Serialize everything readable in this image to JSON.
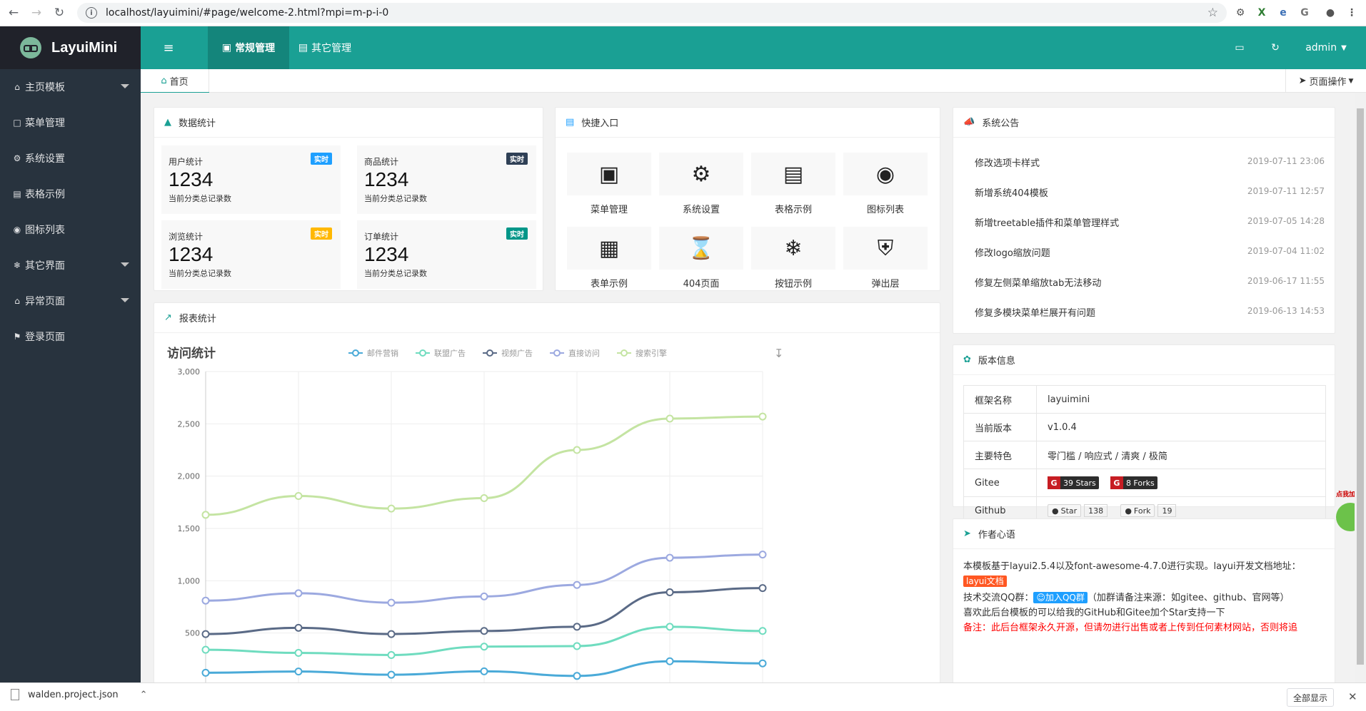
{
  "browser": {
    "url": "localhost/layuimini/#page/welcome-2.html?mpi=m-p-i-0",
    "download_file": "walden.project.json",
    "show_all": "全部显示"
  },
  "sidebar": {
    "logo_text": "LayuiMini",
    "items": [
      {
        "icon": "home-icon",
        "label": "主页模板",
        "has_submenu": true
      },
      {
        "icon": "window-icon",
        "label": "菜单管理",
        "has_submenu": false
      },
      {
        "icon": "gears-icon",
        "label": "系统设置",
        "has_submenu": false
      },
      {
        "icon": "file-icon",
        "label": "表格示例",
        "has_submenu": false
      },
      {
        "icon": "circle-dot-icon",
        "label": "图标列表",
        "has_submenu": false
      },
      {
        "icon": "snowflake-icon",
        "label": "其它界面",
        "has_submenu": true
      },
      {
        "icon": "home-icon",
        "label": "异常页面",
        "has_submenu": true
      },
      {
        "icon": "flag-icon",
        "label": "登录页面",
        "has_submenu": false
      }
    ]
  },
  "header": {
    "menu_tabs": [
      {
        "label": "常规管理",
        "active": true
      },
      {
        "label": "其它管理",
        "active": false
      }
    ],
    "user": "admin"
  },
  "tabs": {
    "home": "首页",
    "page_ops": "页面操作"
  },
  "stats": {
    "title": "数据统计",
    "items": [
      {
        "title": "用户统计",
        "value": "1234",
        "desc": "当前分类总记录数",
        "badge": "实时",
        "badge_color": "#1e9fff"
      },
      {
        "title": "商品统计",
        "value": "1234",
        "desc": "当前分类总记录数",
        "badge": "实时",
        "badge_color": "#2f4056"
      },
      {
        "title": "浏览统计",
        "value": "1234",
        "desc": "当前分类总记录数",
        "badge": "实时",
        "badge_color": "#ffb800"
      },
      {
        "title": "订单统计",
        "value": "1234",
        "desc": "当前分类总记录数",
        "badge": "实时",
        "badge_color": "#009688"
      }
    ]
  },
  "quick": {
    "title": "快捷入口",
    "items": [
      {
        "icon": "window-icon",
        "label": "菜单管理"
      },
      {
        "icon": "gears-icon",
        "label": "系统设置"
      },
      {
        "icon": "file-text-icon",
        "label": "表格示例"
      },
      {
        "icon": "dot-circle-icon",
        "label": "图标列表"
      },
      {
        "icon": "calendar-icon",
        "label": "表单示例"
      },
      {
        "icon": "hourglass-icon",
        "label": "404页面"
      },
      {
        "icon": "snowflake-icon",
        "label": "按钮示例"
      },
      {
        "icon": "shield-icon",
        "label": "弹出层"
      }
    ]
  },
  "report": {
    "title": "报表统计"
  },
  "chart_data": {
    "type": "line",
    "title": "访问统计",
    "ylim": [
      0,
      3000
    ],
    "yticks": [
      "3,000",
      "2,500",
      "2,000",
      "1,500",
      "1,000",
      "500"
    ],
    "x_count": 7,
    "series": [
      {
        "name": "邮件营销",
        "color": "#4aaad8",
        "values": [
          120,
          132,
          101,
          134,
          90,
          230,
          210
        ]
      },
      {
        "name": "联盟广告",
        "color": "#6fdcbf",
        "values": [
          340,
          310,
          290,
          370,
          375,
          560,
          520
        ]
      },
      {
        "name": "视频广告",
        "color": "#5a6a86",
        "values": [
          490,
          550,
          490,
          520,
          560,
          890,
          930
        ]
      },
      {
        "name": "直接访问",
        "color": "#9ca9e0",
        "values": [
          810,
          880,
          790,
          850,
          960,
          1220,
          1250
        ]
      },
      {
        "name": "搜索引擎",
        "color": "#c4e4a2",
        "values": [
          1630,
          1810,
          1690,
          1790,
          2250,
          2550,
          2570
        ]
      }
    ]
  },
  "notice": {
    "title": "系统公告",
    "items": [
      {
        "text": "修改选项卡样式",
        "date": "2019-07-11 23:06"
      },
      {
        "text": "新增系统404模板",
        "date": "2019-07-11 12:57"
      },
      {
        "text": "新增treetable插件和菜单管理样式",
        "date": "2019-07-05 14:28"
      },
      {
        "text": "修改logo缩放问题",
        "date": "2019-07-04 11:02"
      },
      {
        "text": "修复左侧菜单缩放tab无法移动",
        "date": "2019-06-17 11:55"
      },
      {
        "text": "修复多模块菜单栏展开有问题",
        "date": "2019-06-13 14:53"
      }
    ]
  },
  "version": {
    "title": "版本信息",
    "rows": [
      {
        "key": "框架名称",
        "value": "layuimini"
      },
      {
        "key": "当前版本",
        "value": "v1.0.4"
      },
      {
        "key": "主要特色",
        "value": "零门槛 / 响应式 / 清爽 / 极简"
      }
    ],
    "gitee": {
      "key": "Gitee",
      "stars": "39 Stars",
      "forks": "8 Forks"
    },
    "github": {
      "key": "Github",
      "star_label": "Star",
      "star_count": "138",
      "fork_label": "Fork",
      "fork_count": "19"
    }
  },
  "author": {
    "title": "作者心语",
    "line1": "本模板基于layui2.5.4以及font-awesome-4.7.0进行实现。layui开发文档地址：",
    "doc_button": "layui文档",
    "qq_prefix": "技术交流QQ群：",
    "qq_button": "加入QQ群",
    "qq_note": "（加群请备注来源：如gitee、github、官网等）",
    "line3": "喜欢此后台模板的可以给我的GitHub和Gitee加个Star支持一下",
    "note": "备注：此后台框架永久开源，但请勿进行出售或者上传到任何素材网站，否则将追"
  },
  "float_widget": {
    "text": "点我加速"
  }
}
